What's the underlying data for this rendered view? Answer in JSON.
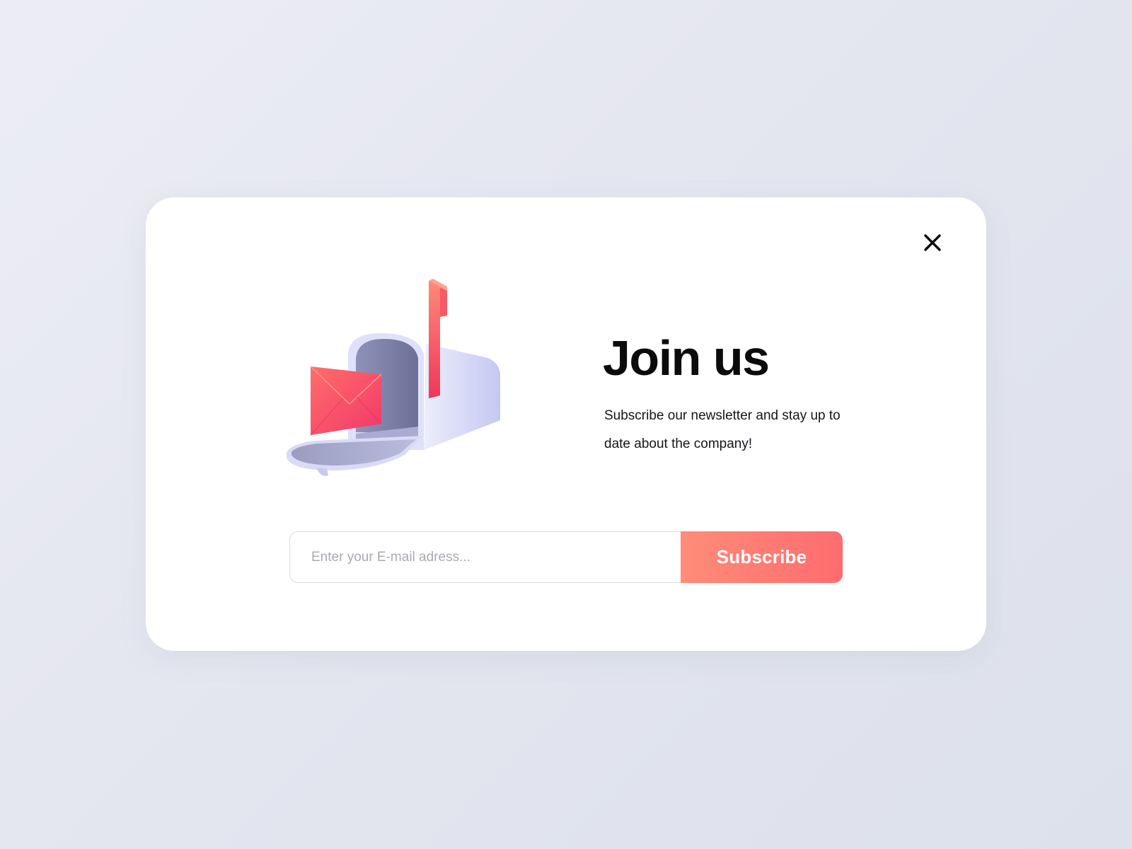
{
  "modal": {
    "title": "Join us",
    "subtitle": "Subscribe our newsletter and stay up to date about the company!",
    "email_input": {
      "value": "",
      "placeholder": "Enter your E-mail adress..."
    },
    "subscribe_label": "Subscribe",
    "icons": {
      "close": "close-icon",
      "illustration": "mailbox-illustration"
    }
  },
  "colors": {
    "accent_start": "#ff8c78",
    "accent_end": "#fd6c6f",
    "title_text": "#0b0b0c",
    "background": "#e6e8f0"
  }
}
